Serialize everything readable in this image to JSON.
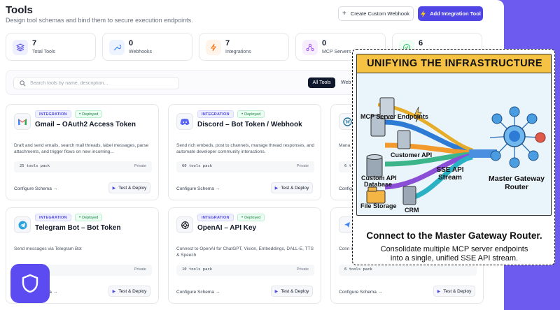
{
  "header": {
    "title": "Tools",
    "subtitle": "Design tool schemas and bind them to secure execution endpoints.",
    "btn_webhook": "Create Custom Webhook",
    "btn_add": "Add Integration Tool"
  },
  "stats": [
    {
      "value": "7",
      "label": "Total Tools"
    },
    {
      "value": "0",
      "label": "Webhooks"
    },
    {
      "value": "7",
      "label": "Integrations"
    },
    {
      "value": "0",
      "label": "MCP Servers"
    },
    {
      "value": "6",
      "label": ""
    }
  ],
  "toolbar": {
    "search_placeholder": "Search tools by name, description...",
    "filter_all": "All Tools",
    "filter_web": "Web"
  },
  "cards": [
    {
      "badge": "INTEGRATION",
      "status": "Deployed",
      "title": "Gmail – OAuth2 Access Token",
      "desc": "Draft and send emails, search mail threads, label messages, parse attachments, and trigger flows on new incoming...",
      "pack": "25 tools pack",
      "visibility": "Private",
      "configure": "Configure Schema →",
      "deploy": "Test & Deploy"
    },
    {
      "badge": "INTEGRATION",
      "status": "Deployed",
      "title": "Discord – Bot Token / Webhook",
      "desc": "Send rich embeds, post to channels, manage thread responses, and automate developer community interactions.",
      "pack": "60 tools pack",
      "visibility": "Private",
      "configure": "Configure Schema →",
      "deploy": "Test & Deploy"
    },
    {
      "desc": "Mana",
      "pack": "6 t",
      "configure": "Configure Schema →"
    },
    {
      "badge": "INTEGRATION",
      "status": "Deployed",
      "title": "Telegram Bot – Bot Token",
      "desc": "Send messages via Telegram Bot",
      "pack": "",
      "visibility": "Private",
      "configure": "Configure Schema →",
      "deploy": "Test & Deploy"
    },
    {
      "badge": "INTEGRATION",
      "status": "Deployed",
      "title": "OpenAI – API Key",
      "desc": "Connect to OpenAI for ChatGPT, Vision, Embeddings, DALL-E, TTS & Speech",
      "pack": "10 tools pack",
      "visibility": "Private",
      "configure": "Configure Schema →",
      "deploy": "Test & Deploy"
    },
    {
      "desc": "Conn & TTS",
      "pack": "6 tools pack",
      "configure": "Configure Schema →",
      "deploy": "Test & Deploy"
    }
  ],
  "infographic": {
    "banner": "UNIFYING THE INFRASTRUCTURE",
    "labels": {
      "mcp": "MCP Server Endpoints",
      "custom_api_1": "Customer API",
      "custom_api_2": "Custom API",
      "database": "Database",
      "file_storage": "File Storage",
      "crm": "CRM",
      "sse": "SSE API Stream",
      "router": "Master Gateway Router"
    },
    "headline": "Connect to the Master Gateway Router.",
    "subline_1": "Consolidate multiple MCP server endpoints",
    "subline_2": "into a single, unified SSE API stream."
  },
  "colors": {
    "accent": "#4f46e5",
    "background": "#6d5bf0",
    "deployed": "#15803d",
    "banner": "#f6c244"
  }
}
